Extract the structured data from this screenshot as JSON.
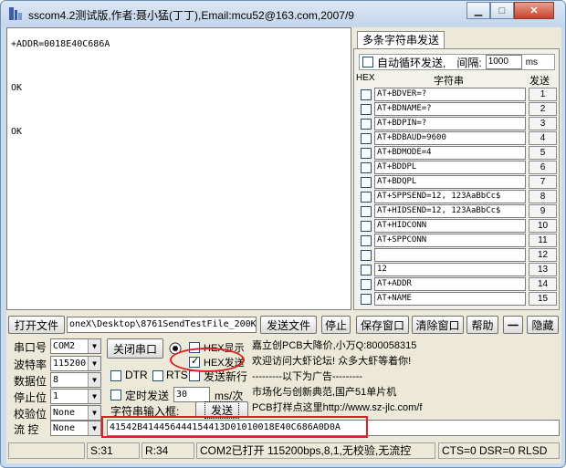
{
  "window": {
    "title": "sscom4.2测试版,作者:聂小猛(丁丁),Email:mcu52@163.com,2007/9",
    "minimize": "▁",
    "maximize": "□",
    "close": "✕"
  },
  "receive": {
    "lines": [
      "+ADDR=0018E40C686A",
      "",
      "OK",
      "",
      "OK"
    ]
  },
  "multi": {
    "tab": "多条字符串发送",
    "auto_loop_label": "自动循环发送,",
    "interval_label": "间隔:",
    "interval_value": "1000",
    "interval_unit": "ms",
    "col_hex": "HEX",
    "col_string": "字符串",
    "col_send": "发送",
    "rows": [
      {
        "cmd": "AT+BDVER=?",
        "num": "1"
      },
      {
        "cmd": "AT+BDNAME=?",
        "num": "2"
      },
      {
        "cmd": "AT+BDPIN=?",
        "num": "3"
      },
      {
        "cmd": "AT+BDBAUD=9600",
        "num": "4"
      },
      {
        "cmd": "AT+BDMODE=4",
        "num": "5"
      },
      {
        "cmd": "AT+BDDPL",
        "num": "6"
      },
      {
        "cmd": "AT+BDQPL",
        "num": "7"
      },
      {
        "cmd": "AT+SPPSEND=12, 123AaBbCc$",
        "num": "8"
      },
      {
        "cmd": "AT+HIDSEND=12, 123AaBbCc$",
        "num": "9"
      },
      {
        "cmd": "AT+HIDCONN",
        "num": "10"
      },
      {
        "cmd": "AT+SPPCONN",
        "num": "11"
      },
      {
        "cmd": "",
        "num": "12"
      },
      {
        "cmd": "12",
        "num": "13"
      },
      {
        "cmd": "AT+ADDR",
        "num": "14"
      },
      {
        "cmd": "AT+NAME",
        "num": "15"
      }
    ]
  },
  "toolbar": {
    "open_file": "打开文件",
    "file_path": "oneX\\Desktop\\8761SendTestFile_200K",
    "send_file": "发送文件",
    "stop": "停止",
    "save_window": "保存窗口",
    "clear_window": "清除窗口",
    "help": "帮助",
    "dash": "一",
    "hide": "隐藏"
  },
  "settings": {
    "port_label": "串口号",
    "port_value": "COM2",
    "baud_label": "波特率",
    "baud_value": "115200",
    "data_label": "数据位",
    "data_value": "8",
    "stop_label": "停止位",
    "stop_value": "1",
    "parity_label": "校验位",
    "parity_value": "None",
    "flow_label": "流 控",
    "flow_value": "None"
  },
  "controls": {
    "close_port": "关闭串口",
    "hex_display": "HEX显示",
    "hex_send": "HEX发送",
    "dtr": "DTR",
    "rts": "RTS",
    "send_newline": "发送新行",
    "timed_send": "定时发送",
    "timed_value": "30",
    "timed_unit": "ms/次",
    "input_label": "字符串输入框:",
    "send": "发送",
    "input_value": "41542B414456444154413D01010018E40C686A0D0A"
  },
  "promo": {
    "lines": [
      "嘉立创PCB大降价,小万Q:800058315",
      "欢迎访问大虾论坛! 众多大虾等着你!",
      "---------以下为广告---------",
      "市场化与创新典范,国产51单片机",
      "PCB打样点这里http://www.sz-jlc.com/f"
    ]
  },
  "statusbar": {
    "s": "S:31",
    "r": "R:34",
    "port_status": "COM2已打开  115200bps,8,1,无校验,无流控",
    "signals": "CTS=0 DSR=0 RLSD"
  },
  "colors": {
    "highlight": "#e02020",
    "window_frame": "#c9dbee",
    "client": "#ece9d8"
  }
}
